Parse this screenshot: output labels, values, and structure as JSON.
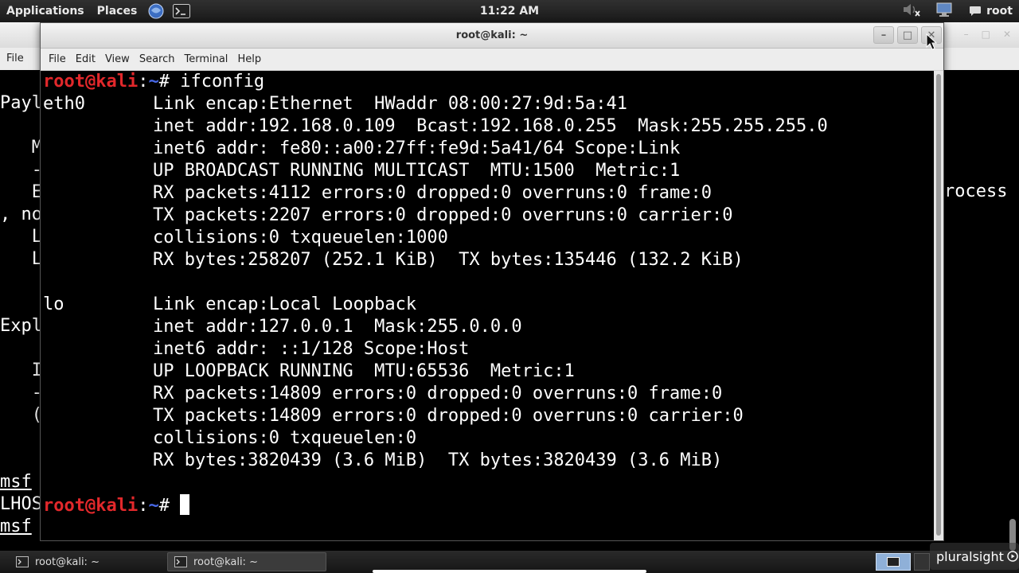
{
  "top_panel": {
    "applications": "Applications",
    "places": "Places",
    "clock": "11:22 AM",
    "user": "root",
    "icons": [
      "browser-icon",
      "terminal-icon",
      "volume-muted-icon",
      "network-icon",
      "chat-icon"
    ]
  },
  "window": {
    "title": "root@kali: ~",
    "controls": [
      "minimize",
      "maximize",
      "close"
    ]
  },
  "menu": [
    "File",
    "Edit",
    "View",
    "Search",
    "Terminal",
    "Help"
  ],
  "background_terminal": {
    "menu_label": "File",
    "lines": [
      "Payl",
      "   M",
      "   -",
      "   E",
      ", no",
      "   L",
      "   L",
      "Expl",
      "   I",
      "   -",
      "   (",
      "msf",
      "LHOS",
      "msf"
    ],
    "right_text": "rocess"
  },
  "terminal": {
    "prompt_user": "root@kali",
    "prompt_sep": ":",
    "prompt_path": "~",
    "prompt_symbol": "# ",
    "command": "ifconfig",
    "eth0": {
      "name": "eth0",
      "lines": [
        "Link encap:Ethernet  HWaddr 08:00:27:9d:5a:41",
        "inet addr:192.168.0.109  Bcast:192.168.0.255  Mask:255.255.255.0",
        "inet6 addr: fe80::a00:27ff:fe9d:5a41/64 Scope:Link",
        "UP BROADCAST RUNNING MULTICAST  MTU:1500  Metric:1",
        "RX packets:4112 errors:0 dropped:0 overruns:0 frame:0",
        "TX packets:2207 errors:0 dropped:0 overruns:0 carrier:0",
        "collisions:0 txqueuelen:1000",
        "RX bytes:258207 (252.1 KiB)  TX bytes:135446 (132.2 KiB)"
      ]
    },
    "lo": {
      "name": "lo",
      "lines": [
        "Link encap:Local Loopback",
        "inet addr:127.0.0.1  Mask:255.0.0.0",
        "inet6 addr: ::1/128 Scope:Host",
        "UP LOOPBACK RUNNING  MTU:65536  Metric:1",
        "RX packets:14809 errors:0 dropped:0 overruns:0 frame:0",
        "TX packets:14809 errors:0 dropped:0 overruns:0 carrier:0",
        "collisions:0 txqueuelen:0",
        "RX bytes:3820439 (3.6 MiB)  TX bytes:3820439 (3.6 MiB)"
      ]
    }
  },
  "taskbar": {
    "tasks": [
      "root@kali: ~",
      "root@kali: ~"
    ],
    "watermark": "pluralsight"
  },
  "colors": {
    "prompt_user": "#e2282b",
    "prompt_path": "#4868e6",
    "terminal_bg": "#000000",
    "terminal_fg": "#ffffff"
  }
}
